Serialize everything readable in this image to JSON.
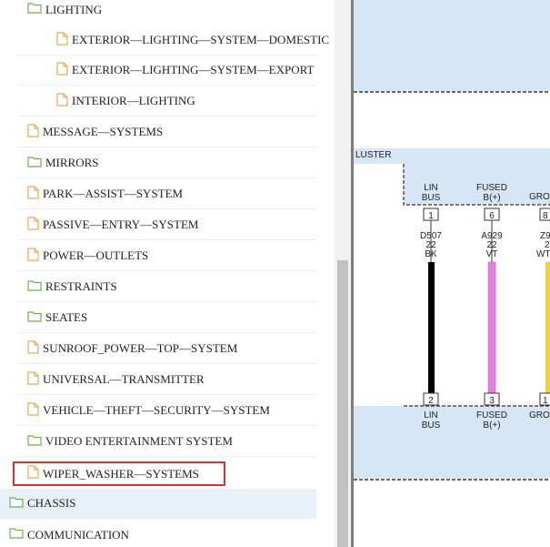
{
  "tree": {
    "items": [
      {
        "label": "LIGHTING",
        "type": "folder"
      },
      {
        "label": "EXTERIOR—LIGHTING—SYSTEM—DOMESTIC",
        "type": "file"
      },
      {
        "label": "EXTERIOR—LIGHTING—SYSTEM—EXPORT",
        "type": "file"
      },
      {
        "label": "INTERIOR—LIGHTING",
        "type": "file"
      },
      {
        "label": "MESSAGE—SYSTEMS",
        "type": "file"
      },
      {
        "label": "MIRRORS",
        "type": "folder"
      },
      {
        "label": "PARK—ASSIST—SYSTEM",
        "type": "file"
      },
      {
        "label": "PASSIVE—ENTRY—SYSTEM",
        "type": "file"
      },
      {
        "label": "POWER—OUTLETS",
        "type": "file"
      },
      {
        "label": "RESTRAINTS",
        "type": "folder"
      },
      {
        "label": "SEATES",
        "type": "folder"
      },
      {
        "label": "SUNROOF_POWER—TOP—SYSTEM",
        "type": "file"
      },
      {
        "label": "UNIVERSAL—TRANSMITTER",
        "type": "file"
      },
      {
        "label": "VEHICLE—THEFT—SECURITY—SYSTEM",
        "type": "file"
      },
      {
        "label": "VIDEO ENTERTAINMENT SYSTEM",
        "type": "folder"
      },
      {
        "label": "WIPER_WASHER—SYSTEMS",
        "type": "file"
      },
      {
        "label": "CHASSIS",
        "type": "folder"
      },
      {
        "label": "COMMUNICATION",
        "type": "folder"
      }
    ]
  },
  "diagram": {
    "cluster_label": "LUSTER",
    "top_pins": [
      {
        "name": "LIN\nBUS",
        "pin": "1",
        "circuit": "D507",
        "gauge": "22",
        "color_code": "BK"
      },
      {
        "name": "FUSED\nB(+)",
        "pin": "6",
        "circuit": "A929",
        "gauge": "22",
        "color_code": "VT"
      },
      {
        "name": "GRO",
        "pin": "8",
        "circuit": "Z9",
        "gauge": "2",
        "color_code": "WT"
      }
    ],
    "bottom_pins": [
      {
        "name": "LIN\nBUS",
        "pin": "2"
      },
      {
        "name": "FUSED\nB(+)",
        "pin": "3"
      },
      {
        "name": "GRO",
        "pin": "1"
      }
    ]
  },
  "colors": {
    "folder_icon": "#6aaf4c",
    "file_icon": "#f0a74a",
    "selection_border": "#d9342b",
    "highlight_row": "#e8f1fa",
    "diagram_band": "#d7e6f5",
    "wire_black": "#000000",
    "wire_violet": "#e67ee6",
    "wire_yellow": "#f0d040"
  }
}
